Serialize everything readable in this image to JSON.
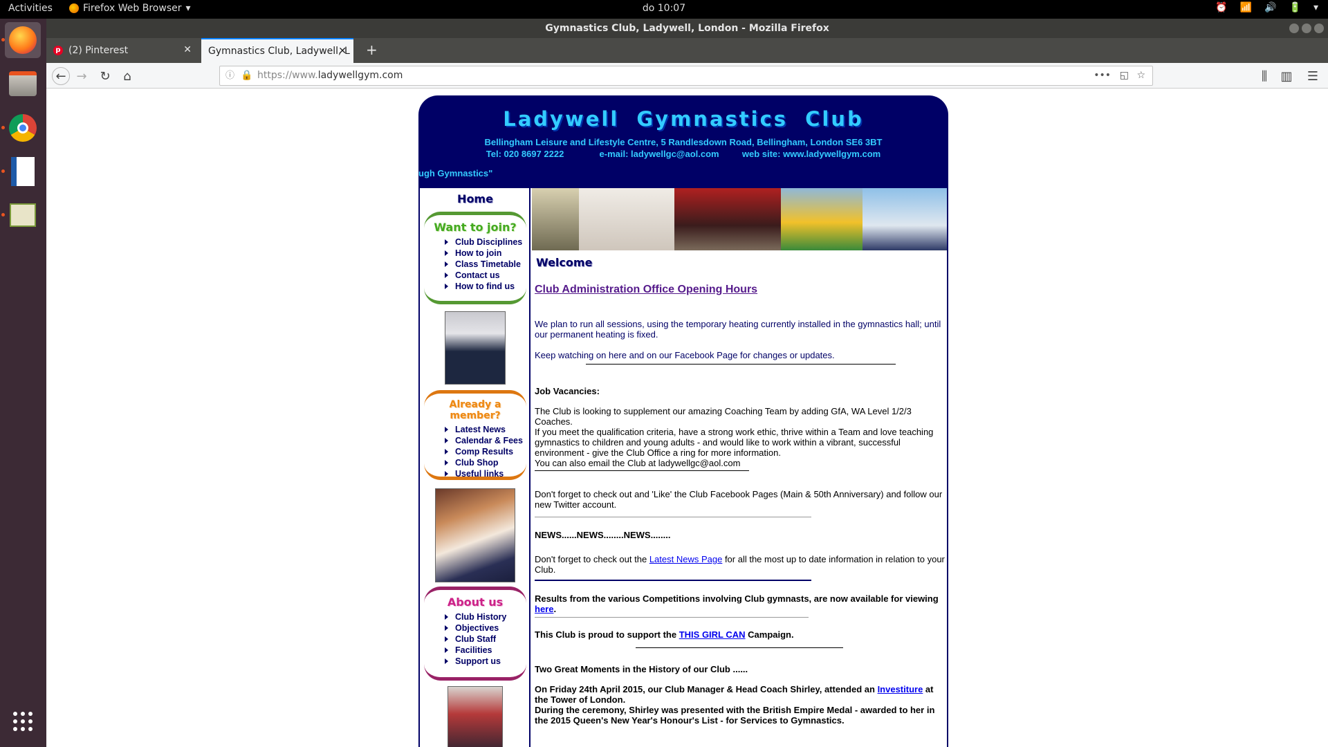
{
  "system": {
    "activities": "Activities",
    "app_name": "Firefox Web Browser",
    "clock": "do 10:07"
  },
  "browser": {
    "window_title": "Gymnastics Club, Ladywell, London - Mozilla Firefox",
    "tabs": [
      {
        "label": "(2) Pinterest",
        "active": false
      },
      {
        "label": "Gymnastics Club, Ladywell, L",
        "active": true
      }
    ],
    "url_protocol": "https://www.",
    "url_host": "ladywellgym.com"
  },
  "site": {
    "title": "Ladywell Gymnastics Club",
    "address": "Bellingham Leisure and Lifestyle Centre, 5 Randlesdown Road, Bellingham, London SE6 3BT",
    "tel": "Tel: 020 8697 2222",
    "email": "e-mail: ladywellgc@aol.com",
    "website": "web site: www.ladywellgym.com",
    "marquee": "ugh Gymnastics\""
  },
  "sidebar": {
    "home": "Home",
    "join": {
      "title": "Want to join?",
      "items": [
        "Club Disciplines",
        "How to join",
        "Class Timetable",
        "Contact us",
        "How to find us"
      ]
    },
    "member": {
      "title": "Already a member?",
      "items": [
        "Latest News",
        "Calendar & Fees",
        "Comp Results",
        "Club Shop",
        "Useful links"
      ]
    },
    "about": {
      "title": "About  us",
      "items": [
        "Club History",
        "Objectives",
        "Club Staff",
        "Facilities",
        "Support us"
      ]
    }
  },
  "content": {
    "welcome": "Welcome",
    "office_hours": "Club Administration Office Opening Hours",
    "heating_1": "We plan to run all sessions, using the temporary heating currently installed in the gymnastics hall; until our permanent heating is fixed.",
    "heating_2": "Keep watching on here and on our Facebook Page for changes or updates.",
    "jobs_heading": "Job Vacancies:",
    "jobs_1": "The Club is looking to supplement our amazing Coaching Team by adding GfA, WA Level 1/2/3 Coaches.",
    "jobs_2": "If you meet the qualification criteria, have a strong work ethic, thrive within a Team and love teaching gymnastics to children and young adults - and would like to work within a vibrant, successful environment - give the Club Office a ring for more information.",
    "jobs_3": "You can also email the Club at ladywellgc@aol.com",
    "facebook": "Don't forget to check out and 'Like' the Club Facebook Pages (Main & 50th Anniversary) and follow our new Twitter account.",
    "news_heading": "NEWS......NEWS........NEWS........",
    "news_pre": "Don't forget to check out the ",
    "news_link": "Latest News Page",
    "news_post": " for all the most up to date information in relation to your Club.",
    "results_pre": "Results from the various Competitions involving Club gymnasts, are now available for viewing ",
    "results_link": "here",
    "results_post": ".",
    "tgc_pre": "This Club is proud to support the ",
    "tgc_link": "THIS GIRL CAN",
    "tgc_post": " Campaign.",
    "moments_heading": "Two Great Moments in the History of our Club ......",
    "moments_1_pre": "On Friday 24th April 2015, our Club Manager & Head Coach Shirley, attended an ",
    "moments_1_link": "Investiture",
    "moments_1_post": " at the Tower of London.",
    "moments_2": "During the ceremony, Shirley was presented with the British Empire Medal - awarded to her in the 2015 Queen's New Year's Honour's List - for Services to Gymnastics."
  }
}
